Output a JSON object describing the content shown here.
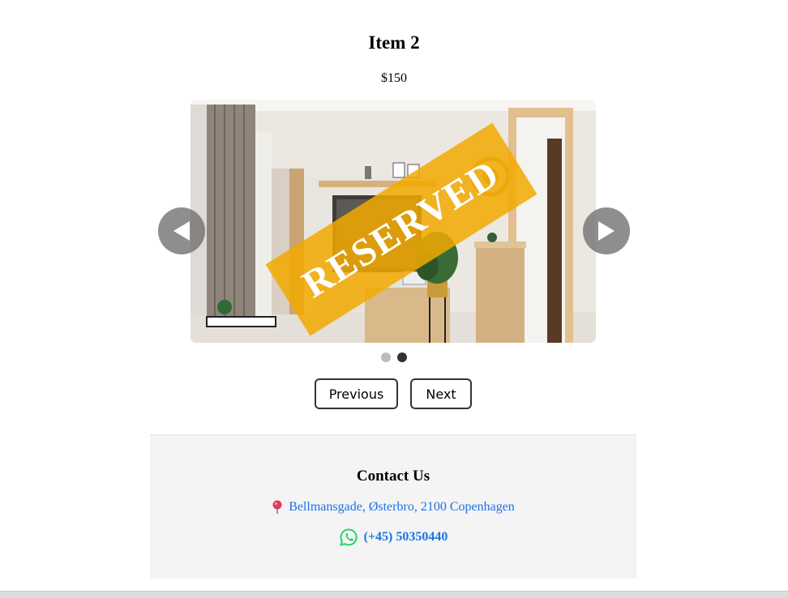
{
  "item": {
    "title": "Item 2",
    "price": "$150"
  },
  "carousel": {
    "overlay_text": "RESERVED",
    "slide_count": 2,
    "active_slide": 2
  },
  "buttons": {
    "previous_label": "Previous",
    "next_label": "Next"
  },
  "contact": {
    "title": "Contact Us",
    "address": "Bellmansgade, Østerbro, 2100 Copenhagen",
    "phone": "(+45) 50350440",
    "address_icon": "map-pin-icon",
    "phone_icon": "whatsapp-icon"
  },
  "colors": {
    "link": "#1a73e8",
    "reserved_banner": "#f2a900",
    "contact_bg": "#f4f4f4",
    "whatsapp": "#25d366"
  }
}
